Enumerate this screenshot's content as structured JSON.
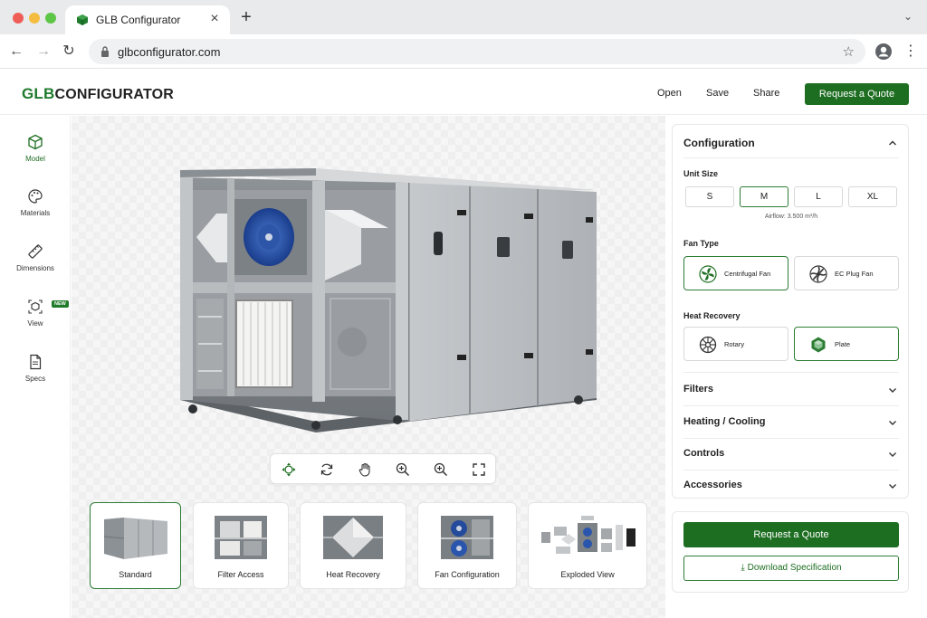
{
  "browser": {
    "tab_title": "GLB Configurator",
    "url": "glbconfigurator.com"
  },
  "header": {
    "logo_primary": "GLB",
    "logo_secondary": "CONFIGURATOR",
    "links": [
      "Open",
      "Save",
      "Share"
    ],
    "cta": "Request a Quote"
  },
  "rail": {
    "items": [
      {
        "label": "Model",
        "icon": "cube-icon",
        "active": true
      },
      {
        "label": "Materials",
        "icon": "palette-icon"
      },
      {
        "label": "Dimensions",
        "icon": "ruler-icon"
      },
      {
        "label": "View",
        "icon": "view-cube-icon",
        "badge": "NEW"
      },
      {
        "label": "Specs",
        "icon": "document-icon"
      }
    ]
  },
  "toolbar": {
    "tools": [
      "move-icon",
      "rotate-icon",
      "pan-hand-icon",
      "zoom-in-icon",
      "zoom-out-icon",
      "fullscreen-icon"
    ]
  },
  "thumbnails": [
    {
      "label": "Standard",
      "active": true
    },
    {
      "label": "Filter Access"
    },
    {
      "label": "Heat Recovery"
    },
    {
      "label": "Fan Configuration"
    },
    {
      "label": "Exploded View"
    }
  ],
  "panel": {
    "title": "Configuration",
    "unit_size": {
      "label": "Unit Size",
      "options": [
        "S",
        "M",
        "L",
        "XL"
      ],
      "selected": "M",
      "airflow": "Airflow: 3.500 m³/h"
    },
    "fan_type": {
      "label": "Fan Type",
      "options": [
        "Centrifugal Fan",
        "EC Plug Fan"
      ],
      "selected": "Centrifugal Fan"
    },
    "heat_recovery": {
      "label": "Heat Recovery",
      "options": [
        "Rotary",
        "Plate"
      ],
      "selected": "Plate"
    },
    "accordions": [
      "Filters",
      "Heating / Cooling",
      "Controls",
      "Accessories"
    ]
  },
  "actions": {
    "primary": "Request a Quote",
    "secondary": "Download Specification"
  },
  "colors": {
    "accent": "#1e6e22",
    "accent_border": "#2c7d34"
  }
}
